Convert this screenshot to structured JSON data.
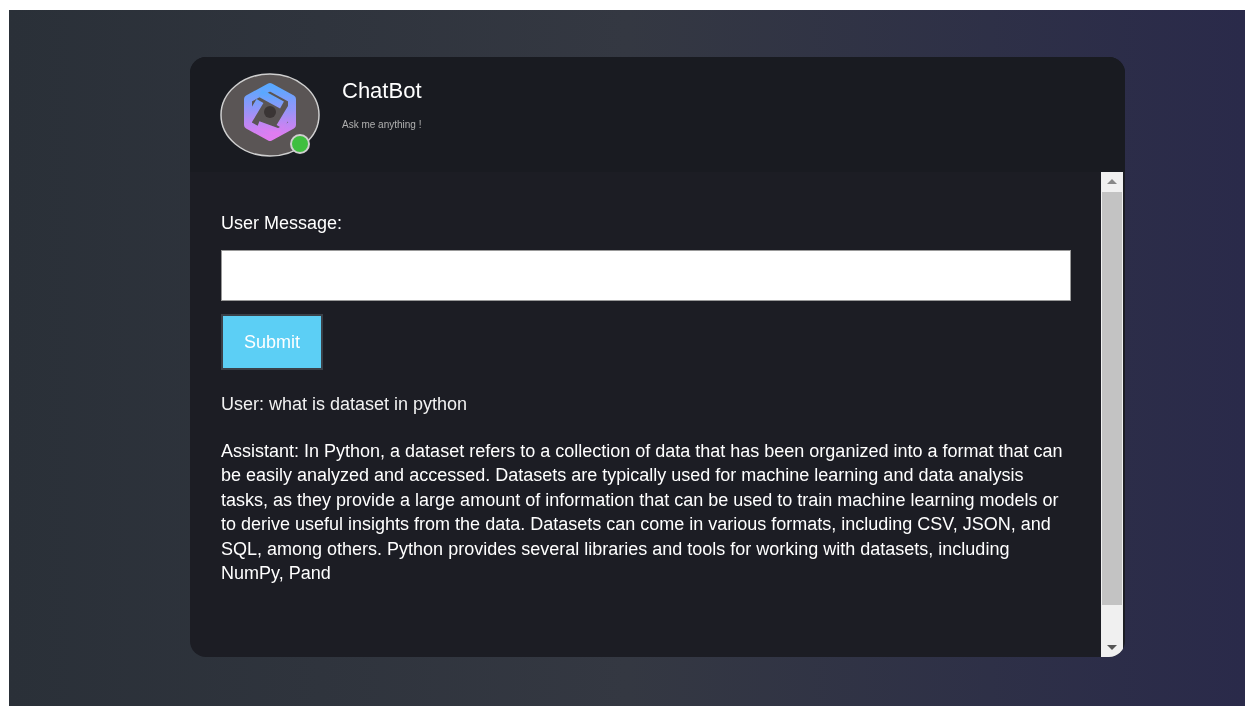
{
  "header": {
    "title": "ChatBot",
    "subtitle": "Ask me anything !",
    "online": true
  },
  "form": {
    "label": "User Message:",
    "button": "Submit"
  },
  "messages": [
    {
      "kind": "user",
      "text": "User: what is dataset in python"
    },
    {
      "kind": "assistant",
      "text": "Assistant: In Python, a dataset refers to a collection of data that has been organized into a format that can be easily analyzed and accessed. Datasets are typically used for machine learning and data analysis tasks, as they provide a large amount of information that can be used to train machine learning models or to derive useful insights from the data. Datasets can come in various formats, including CSV, JSON, and SQL, among others. Python provides several libraries and tools for working with datasets, including NumPy, Pand"
    }
  ]
}
